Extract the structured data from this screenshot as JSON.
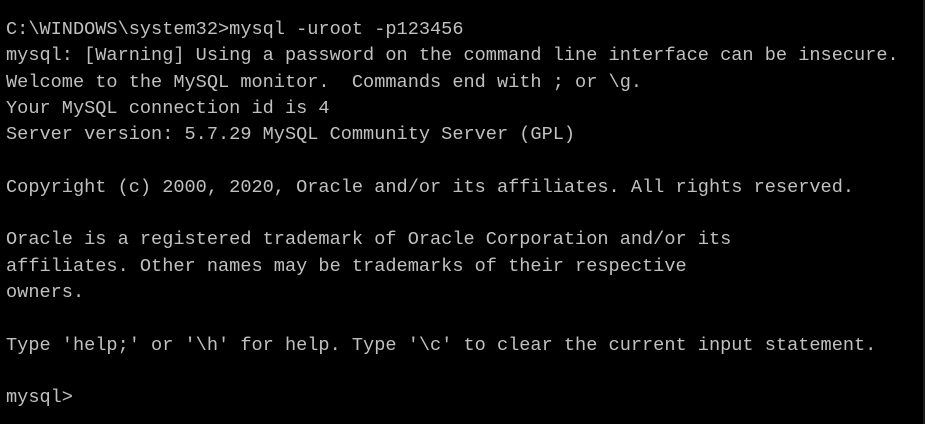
{
  "console": {
    "lines": [
      "C:\\WINDOWS\\system32>mysql -uroot -p123456",
      "mysql: [Warning] Using a password on the command line interface can be insecure.",
      "Welcome to the MySQL monitor.  Commands end with ; or \\g.",
      "Your MySQL connection id is 4",
      "Server version: 5.7.29 MySQL Community Server (GPL)",
      "",
      "Copyright (c) 2000, 2020, Oracle and/or its affiliates. All rights reserved.",
      "",
      "Oracle is a registered trademark of Oracle Corporation and/or its",
      "affiliates. Other names may be trademarks of their respective",
      "owners.",
      "",
      "Type 'help;' or '\\h' for help. Type '\\c' to clear the current input statement.",
      "",
      "mysql>"
    ]
  },
  "colors": {
    "background": "#000000",
    "text": "#c0c0c0"
  }
}
